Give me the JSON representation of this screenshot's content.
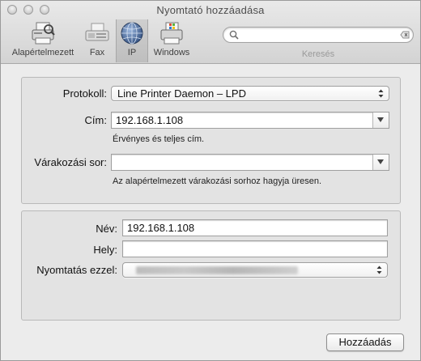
{
  "window": {
    "title": "Nyomtató hozzáadása"
  },
  "toolbar": {
    "items": [
      {
        "label": "Alapértelmezett",
        "icon": "default-printer-icon"
      },
      {
        "label": "Fax",
        "icon": "fax-icon"
      },
      {
        "label": "IP",
        "icon": "ip-globe-icon",
        "selected": true
      },
      {
        "label": "Windows",
        "icon": "windows-printer-icon"
      }
    ],
    "search": {
      "value": "",
      "placeholder": "",
      "caption": "Keresés"
    }
  },
  "ip_settings": {
    "protocol_label": "Protokoll:",
    "protocol_value": "Line Printer Daemon – LPD",
    "address_label": "Cím:",
    "address_value": "192.168.1.108",
    "address_hint": "Érvényes és teljes cím.",
    "queue_label": "Várakozási sor:",
    "queue_value": "",
    "queue_hint": "Az alapértelmezett várakozási sorhoz hagyja üresen."
  },
  "printer_info": {
    "name_label": "Név:",
    "name_value": "192.168.1.108",
    "location_label": "Hely:",
    "location_value": "",
    "print_using_label": "Nyomtatás ezzel:"
  },
  "actions": {
    "add_label": "Hozzáadás"
  }
}
